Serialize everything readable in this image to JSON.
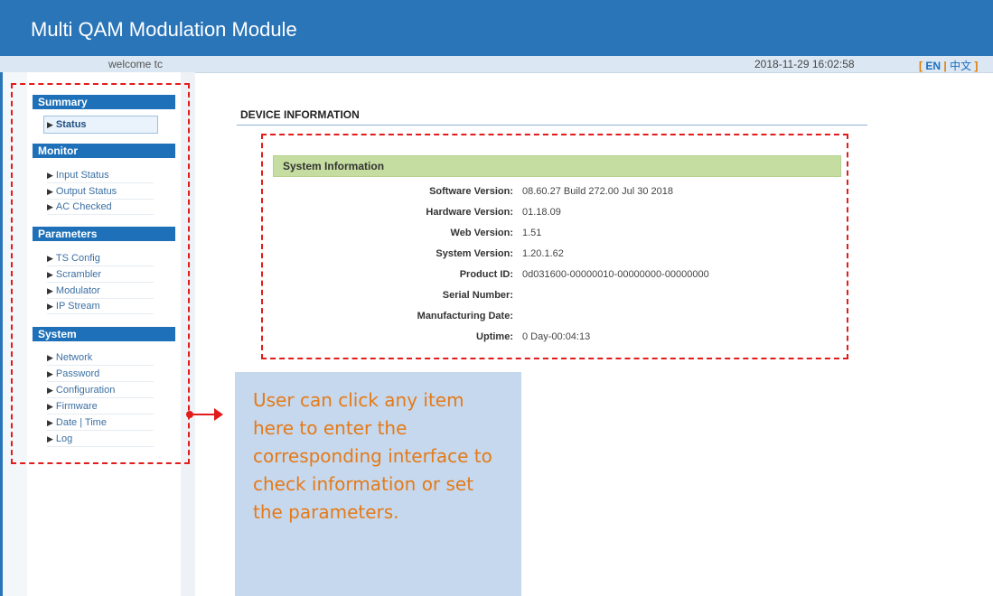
{
  "header": {
    "title": "Multi QAM Modulation Module"
  },
  "subbar": {
    "welcome": "welcome tc",
    "datetime": "2018-11-29 16:02:58",
    "lang_open": "[",
    "lang_en": "EN",
    "lang_sep": " | ",
    "lang_cn": "中文",
    "lang_close": "]"
  },
  "sidebar": {
    "sections": [
      {
        "title": "Summary",
        "items": [
          "Status"
        ]
      },
      {
        "title": "Monitor",
        "items": [
          "Input Status",
          "Output Status",
          "AC Checked"
        ]
      },
      {
        "title": "Parameters",
        "items": [
          "TS Config",
          "Scrambler",
          "Modulator",
          "IP Stream"
        ]
      },
      {
        "title": "System",
        "items": [
          "Network",
          "Password",
          "Configuration",
          "Firmware",
          "Date | Time",
          "Log"
        ]
      }
    ],
    "active_item": "Status",
    "triangle": "▶"
  },
  "main": {
    "title": "DEVICE INFORMATION",
    "section_title": "System Information",
    "fields": [
      {
        "label": "Software Version:",
        "value": "08.60.27 Build 272.00 Jul 30 2018"
      },
      {
        "label": "Hardware Version:",
        "value": "01.18.09"
      },
      {
        "label": "Web Version:",
        "value": "1.51"
      },
      {
        "label": "System Version:",
        "value": "1.20.1.62"
      },
      {
        "label": "Product ID:",
        "value": "0d031600-00000010-00000000-00000000"
      },
      {
        "label": "Serial Number:",
        "value": ""
      },
      {
        "label": "Manufacturing Date:",
        "value": ""
      },
      {
        "label": "Uptime:",
        "value": "0 Day-00:04:13"
      }
    ]
  },
  "callout": {
    "text": "User can click any item here to enter the corresponding interface to check information or set the parameters."
  },
  "colors": {
    "header": "#2a74b8",
    "section_head": "#1e71b8",
    "sysinfo_bar": "#c5dda0",
    "annotation_red": "#e21b1b",
    "callout_bg": "#c6d8ee",
    "callout_text": "#e47a18"
  }
}
